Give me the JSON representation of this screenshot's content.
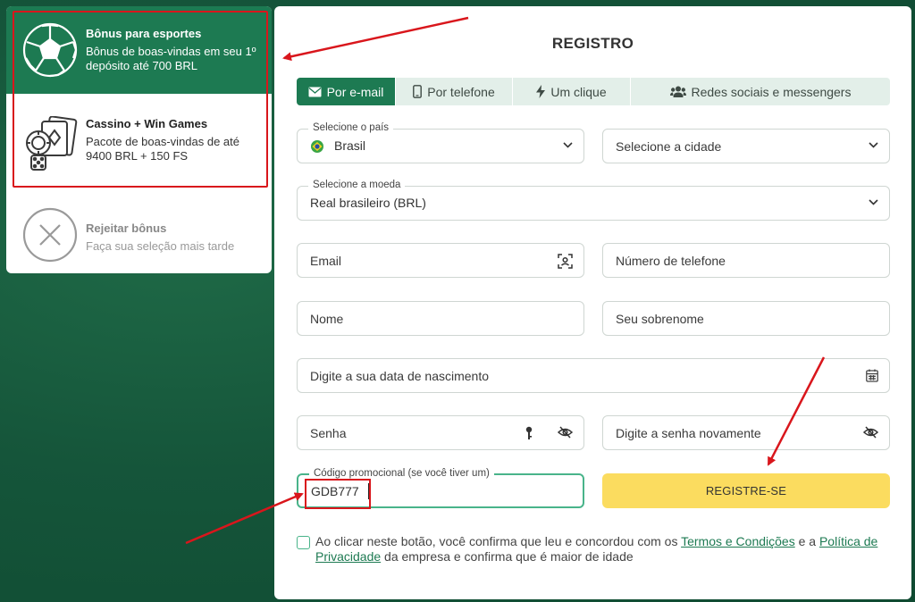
{
  "bonus": {
    "items": [
      {
        "title": "Bônus para esportes",
        "desc": "Bônus de boas-vindas em seu 1º depósito até 700 BRL",
        "icon": "soccer-ball-icon"
      },
      {
        "title": "Cassino + Win Games",
        "desc": "Pacote de boas-vindas de até 9400 BRL + 150 FS",
        "icon": "casino-cards-icon"
      },
      {
        "title": "Rejeitar bônus",
        "desc": "Faça sua seleção mais tarde",
        "icon": "close-circle-icon"
      }
    ]
  },
  "form": {
    "title": "REGISTRO",
    "tabs": [
      {
        "label": "Por e-mail",
        "icon": "envelope-icon",
        "active": true
      },
      {
        "label": "Por telefone",
        "icon": "phone-icon"
      },
      {
        "label": "Um clique",
        "icon": "lightning-icon"
      },
      {
        "label": "Redes sociais e messengers",
        "icon": "users-icon"
      }
    ],
    "country": {
      "legend": "Selecione o país",
      "value": "Brasil"
    },
    "city": {
      "placeholder": "Selecione a cidade"
    },
    "currency": {
      "legend": "Selecione a moeda",
      "value": "Real brasileiro (BRL)"
    },
    "email": {
      "placeholder": "Email"
    },
    "phone": {
      "placeholder": "Número de telefone"
    },
    "name": {
      "placeholder": "Nome"
    },
    "surname": {
      "placeholder": "Seu sobrenome"
    },
    "birthdate": {
      "placeholder": "Digite a sua data de nascimento"
    },
    "password": {
      "placeholder": "Senha"
    },
    "password_repeat": {
      "placeholder": "Digite a senha novamente"
    },
    "promo": {
      "legend": "Código promocional (se você tiver um)",
      "value": "GDB777"
    },
    "register_label": "REGISTRE-SE",
    "consent": {
      "part1": "Ao clicar neste botão, você confirma que leu e concordou com os ",
      "terms_link": "Termos e Condições",
      "part2": " e a ",
      "privacy_link": "Política de Privacidade",
      "part3": " da empresa e confirma que é maior de idade"
    }
  },
  "colors": {
    "brand_green": "#1d7a52",
    "tab_bg": "#e3efe9",
    "register_yellow": "#fbdc5f",
    "annotation_red": "#d9161c"
  }
}
